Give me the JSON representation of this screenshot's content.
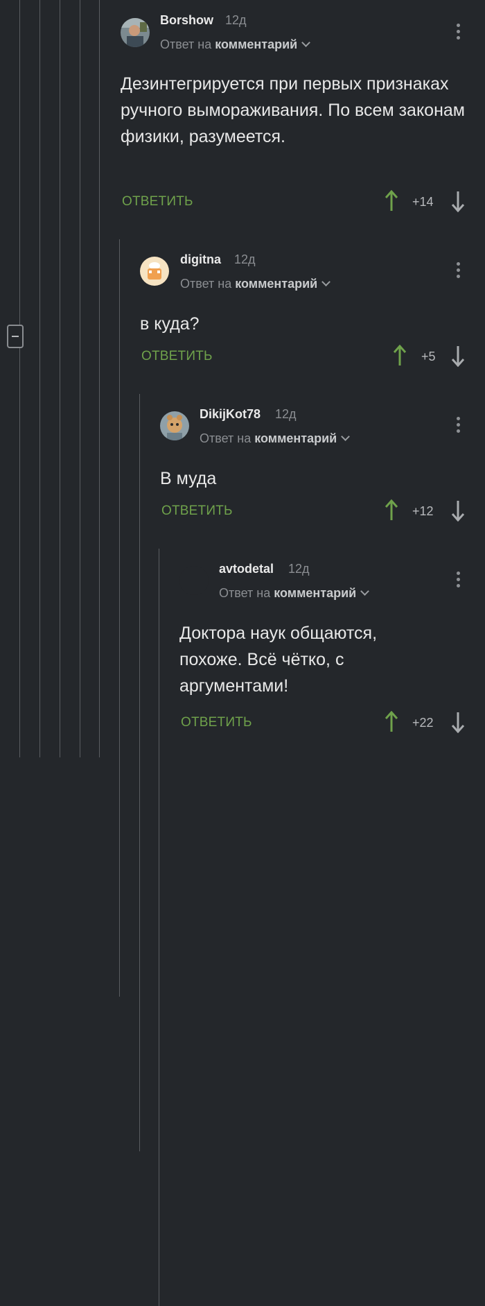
{
  "comments": [
    {
      "author": "Borshow",
      "time": "12д",
      "reply_prefix": "Ответ на",
      "reply_target": "комментарий",
      "text": "Дезинтегрируется при первых признаках ручного вымораживания. По всем законам физики, разумеется.",
      "reply_label": "ОТВЕТИТЬ",
      "score": "+14"
    },
    {
      "author": "digitna",
      "time": "12д",
      "reply_prefix": "Ответ на",
      "reply_target": "комментарий",
      "text": "в куда?",
      "reply_label": "ОТВЕТИТЬ",
      "score": "+5"
    },
    {
      "author": "DikijKot78",
      "time": "12д",
      "reply_prefix": "Ответ на",
      "reply_target": "комментарий",
      "text": "В муда",
      "reply_label": "ОТВЕТИТЬ",
      "score": "+12"
    },
    {
      "author": "avtodetal",
      "time": "12д",
      "reply_prefix": "Ответ на",
      "reply_target": "комментарий",
      "text": "Доктора наук общаются, похоже. Всё чётко, с аргументами!",
      "reply_label": "ОТВЕТИТЬ",
      "score": "+22"
    }
  ],
  "colors": {
    "background": "#24272b",
    "reply_green": "#6fa24b",
    "upvote_green": "#6fa24b",
    "thread_line": "#5a5d61"
  },
  "icons": [
    "collapse-thread-icon",
    "more-vertical-icon",
    "chevron-down-icon",
    "upvote-arrow-icon",
    "downvote-arrow-icon"
  ]
}
